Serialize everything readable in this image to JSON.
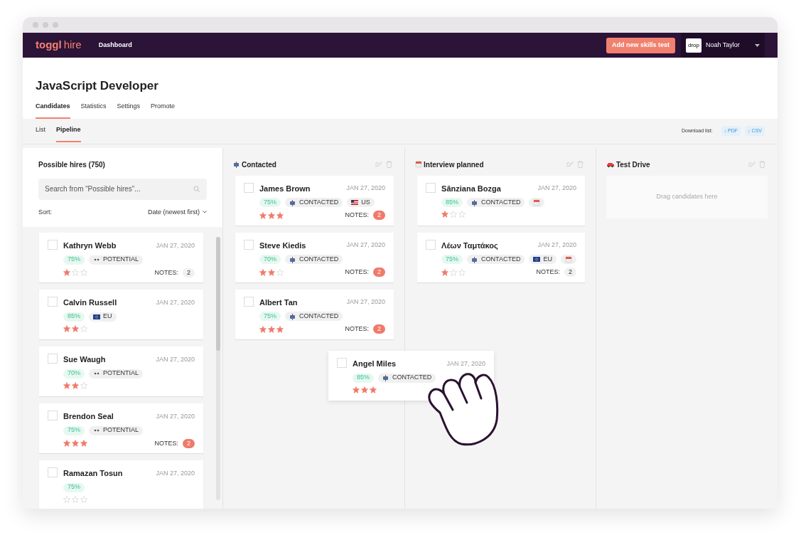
{
  "nav": {
    "logo_main": "toggl",
    "logo_sub": "hire",
    "links": [
      {
        "label": "Dashboard",
        "selected": true
      }
    ],
    "cta": "Add new skills test",
    "avatar": "drop",
    "user": "Noah Taylor"
  },
  "title": "JavaScript Developer",
  "tabs": [
    {
      "label": "Candidates",
      "selected": true
    },
    {
      "label": "Statistics",
      "selected": false
    },
    {
      "label": "Settings",
      "selected": false
    },
    {
      "label": "Promote",
      "selected": false
    }
  ],
  "subtabs": [
    {
      "label": "List",
      "selected": false
    },
    {
      "label": "Pipeline",
      "selected": true
    }
  ],
  "download": {
    "label": "Download list:",
    "buttons": [
      {
        "arrow": "↓",
        "label": "PDF"
      },
      {
        "arrow": "↓",
        "label": "CSV"
      }
    ]
  },
  "possible_hires": {
    "title": "Possible hires (750)",
    "search_placeholder": "Search from “Possible hires”...",
    "sort_label": "Sort:",
    "sort_value": "Date (newest first)",
    "cards": [
      {
        "checked": false,
        "name": "Kathryn Webb",
        "date": "JAN 27, 2020",
        "score": "75%",
        "tags": [
          {
            "kind": "potential",
            "label": "POTENTIAL"
          }
        ],
        "stars": 1,
        "notes_label": "NOTES:",
        "notes": "2",
        "notes_new": false
      },
      {
        "checked": false,
        "name": "Calvin Russell",
        "date": "JAN 27, 2020",
        "score": "85%",
        "tags": [
          {
            "kind": "flag-eu",
            "label": "EU"
          }
        ],
        "stars": 2
      },
      {
        "checked": false,
        "name": "Sue Waugh",
        "date": "JAN 27, 2020",
        "score": "70%",
        "tags": [
          {
            "kind": "potential",
            "label": "POTENTIAL"
          }
        ],
        "stars": 2
      },
      {
        "checked": false,
        "name": "Brendon Seal",
        "date": "JAN 27, 2020",
        "score": "75%",
        "tags": [
          {
            "kind": "potential",
            "label": "POTENTIAL"
          }
        ],
        "stars": 3,
        "notes_label": "NOTES:",
        "notes": "2",
        "notes_new": true
      },
      {
        "checked": false,
        "name": "Ramazan Tosun",
        "date": "JAN 27, 2020",
        "score": "75%",
        "stars": 0
      }
    ]
  },
  "columns": [
    {
      "kind": "contacted",
      "title": "Contacted",
      "cards": [
        {
          "checked": false,
          "name": "James Brown",
          "date": "JAN 27, 2020",
          "score": "75%",
          "tags": [
            {
              "kind": "contacted",
              "label": "CONTACTED"
            },
            {
              "kind": "flag-us",
              "label": "US"
            }
          ],
          "stars": 3,
          "notes_label": "NOTES:",
          "notes": "2",
          "notes_new": true
        },
        {
          "checked": false,
          "name": "Steve Kiedis",
          "date": "JAN 27, 2020",
          "score": "70%",
          "tags": [
            {
              "kind": "contacted",
              "label": "CONTACTED"
            }
          ],
          "stars": 2,
          "notes_label": "NOTES:",
          "notes": "2",
          "notes_new": true
        },
        {
          "checked": false,
          "name": "Albert Tan",
          "date": "JAN 27, 2020",
          "score": "75%",
          "tags": [
            {
              "kind": "contacted",
              "label": "CONTACTED"
            }
          ],
          "stars": 3,
          "notes_label": "NOTES:",
          "notes": "2",
          "notes_new": true
        }
      ]
    },
    {
      "kind": "interview",
      "title": "Interview planned",
      "cards": [
        {
          "checked": false,
          "name": "Sânziana Bozga",
          "date": "JAN 27, 2020",
          "score": "85%",
          "tags": [
            {
              "kind": "contacted",
              "label": "CONTACTED"
            },
            {
              "kind": "calendar"
            }
          ],
          "stars": 1
        },
        {
          "checked": false,
          "name": "Λέων Ταμτάκος",
          "date": "JAN 27, 2020",
          "score": "75%",
          "tags": [
            {
              "kind": "contacted",
              "label": "CONTACTED"
            },
            {
              "kind": "flag-eu",
              "label": "EU"
            },
            {
              "kind": "calendar"
            }
          ],
          "stars": 1,
          "notes_label": "NOTES:",
          "notes": "2",
          "notes_new": false
        }
      ]
    },
    {
      "kind": "test-drive",
      "title": "Test Drive",
      "empty_text": "Drag candidates here"
    }
  ],
  "dragged_card": {
    "checked": false,
    "name": "Angel Miles",
    "date": "JAN 27, 2020",
    "score": "85%",
    "tags": [
      {
        "kind": "contacted",
        "label": "CONTACTED"
      }
    ],
    "stars": 3
  }
}
